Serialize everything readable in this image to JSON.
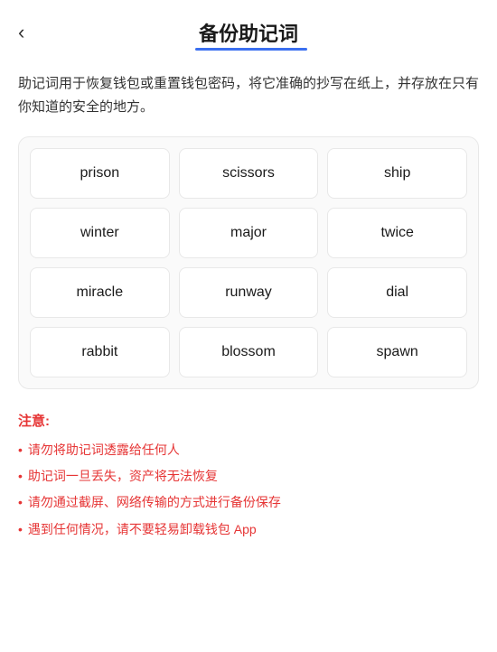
{
  "header": {
    "back_label": "‹",
    "title": "备份助记词"
  },
  "description": "助记词用于恢复钱包或重置钱包密码，将它准确的抄写在纸上，并存放在只有你知道的安全的地方。",
  "grid": {
    "words": [
      "prison",
      "scissors",
      "ship",
      "winter",
      "major",
      "twice",
      "miracle",
      "runway",
      "dial",
      "rabbit",
      "blossom",
      "spawn"
    ]
  },
  "notice": {
    "title": "注意:",
    "items": [
      "请勿将助记词透露给任何人",
      "助记词一旦丢失，资产将无法恢复",
      "请勿通过截屏、网络传输的方式进行备份保存",
      "遇到任何情况，请不要轻易卸载钱包 App"
    ]
  }
}
